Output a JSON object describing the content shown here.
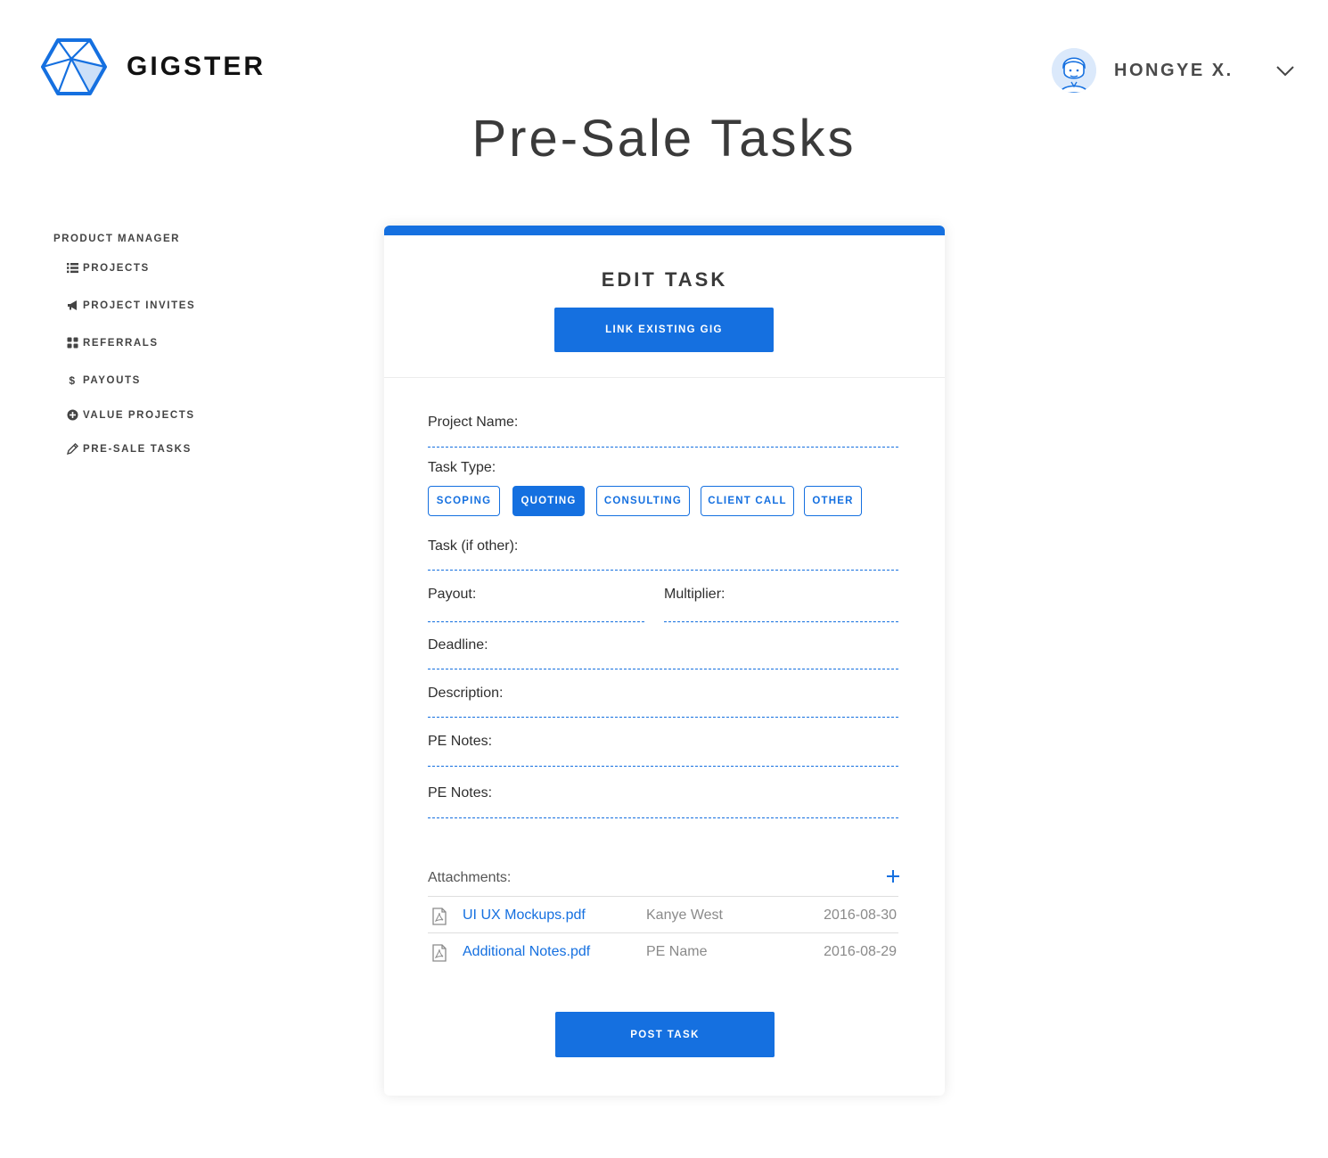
{
  "brand": {
    "name": "GIGSTER",
    "accent": "#1570e0"
  },
  "user": {
    "name": "HONGYE X."
  },
  "page": {
    "title": "Pre-Sale Tasks"
  },
  "sidebar": {
    "heading": "PRODUCT MANAGER",
    "items": [
      {
        "label": "PROJECTS",
        "icon": "list-icon"
      },
      {
        "label": "PROJECT INVITES",
        "icon": "megaphone-icon"
      },
      {
        "label": "REFERRALS",
        "icon": "grid-icon"
      },
      {
        "label": "PAYOUTS",
        "icon": "dollar-icon"
      },
      {
        "label": "VALUE PROJECTS",
        "icon": "circle-plus-icon"
      },
      {
        "label": "PRE-SALE TASKS",
        "icon": "pencil-icon"
      }
    ]
  },
  "form": {
    "title": "EDIT TASK",
    "link_gig_label": "LINK EXISTING GIG",
    "labels": {
      "project_name": "Project Name:",
      "task_type": "Task Type:",
      "task_other": "Task (if other):",
      "payout": "Payout:",
      "multiplier": "Multiplier:",
      "deadline": "Deadline:",
      "description": "Description:",
      "pe_notes_1": "PE Notes:",
      "pe_notes_2": "PE Notes:"
    },
    "task_types": [
      {
        "label": "SCOPING",
        "active": false
      },
      {
        "label": "QUOTING",
        "active": true
      },
      {
        "label": "CONSULTING",
        "active": false
      },
      {
        "label": "CLIENT CALL",
        "active": false
      },
      {
        "label": "OTHER",
        "active": false
      }
    ],
    "attachments": {
      "label": "Attachments:",
      "files": [
        {
          "name": "UI UX Mockups.pdf",
          "owner": "Kanye West",
          "date": "2016-08-30"
        },
        {
          "name": "Additional Notes.pdf",
          "owner": "PE Name",
          "date": "2016-08-29"
        }
      ]
    },
    "submit_label": "POST TASK"
  }
}
